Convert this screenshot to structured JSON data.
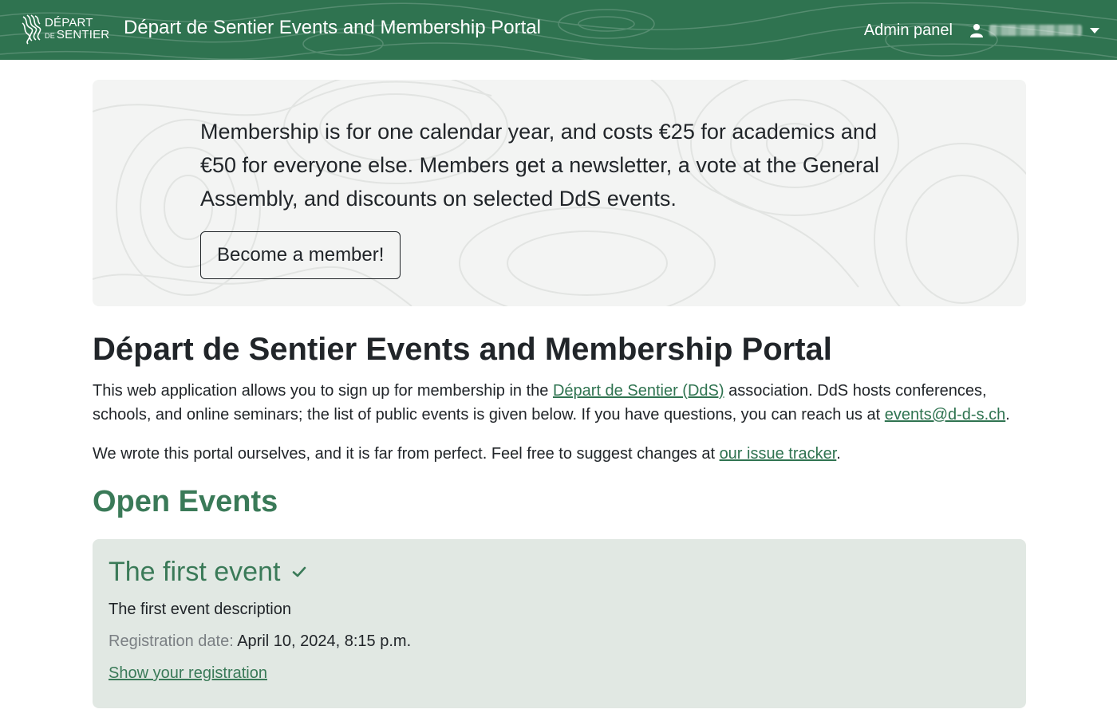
{
  "navbar": {
    "logo_line1": "DÉPART",
    "logo_line2_small": "DE",
    "logo_line2": "SENTIER",
    "title": "Départ de Sentier Events and Membership Portal",
    "admin_link": "Admin panel",
    "user_icon": "user-icon",
    "caret_icon": "caret-down-icon",
    "background_color": "#2f7350"
  },
  "hero": {
    "text": "Membership is for one calendar year, and costs €25 for academics and €50 for everyone else. Members get a newsletter, a vote at the General Assembly, and discounts on selected DdS events.",
    "button_label": "Become a member!"
  },
  "main": {
    "title": "Départ de Sentier Events and Membership Portal",
    "intro_part1": "This web application allows you to sign up for membership in the ",
    "intro_link": "Départ de Sentier (DdS)",
    "intro_part2": " association. DdS hosts conferences, schools, and online seminars; the list of public events is given below. If you have questions, you can reach us at ",
    "intro_email": "events@d-d-s.ch",
    "intro_part3": ".",
    "feedback_part1": "We wrote this portal ourselves, and it is far from perfect. Feel free to suggest changes at ",
    "feedback_link": "our issue tracker",
    "feedback_part2": ".",
    "section_title": "Open Events"
  },
  "events": [
    {
      "title": "The first event",
      "status_icon": "check-icon",
      "description": "The first event description",
      "registration_label": "Registration date:",
      "registration_value": "April 10, 2024, 8:15 p.m.",
      "link_label": "Show your registration"
    }
  ],
  "colors": {
    "accent": "#3a7a58",
    "nav": "#2f7350",
    "card_bg": "#e1e8e3",
    "hero_bg": "#f3f4f3"
  }
}
